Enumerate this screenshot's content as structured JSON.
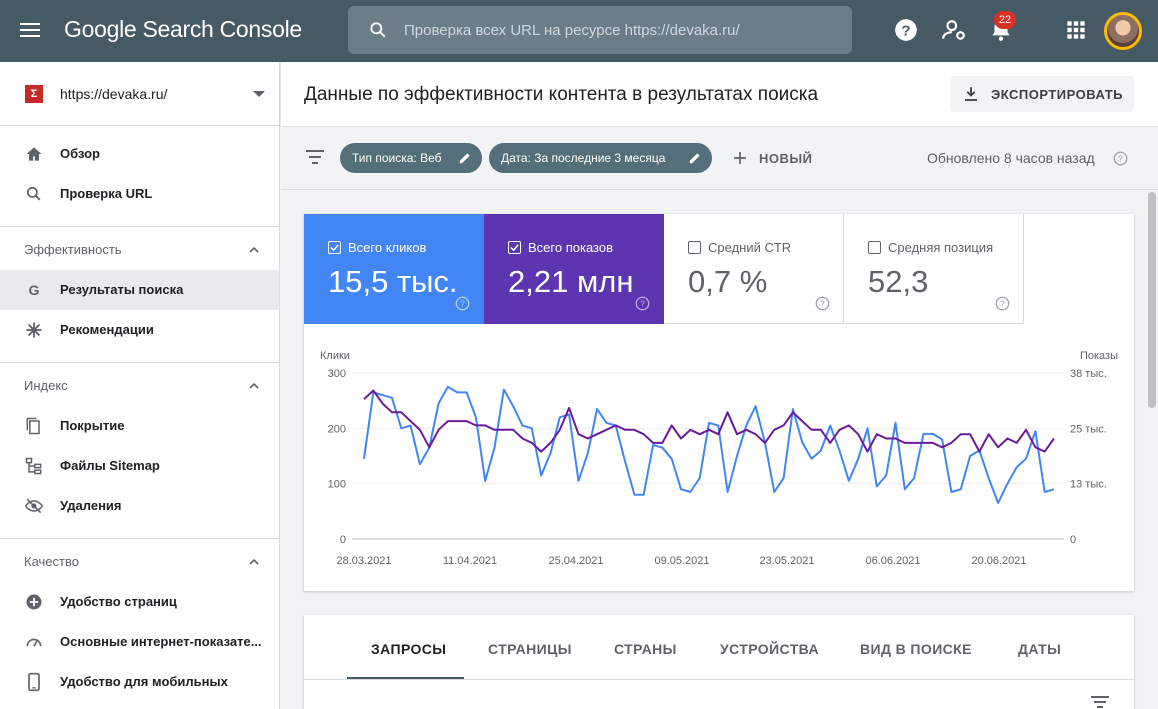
{
  "app": {
    "title": "Google Search Console",
    "search_placeholder": "Проверка всех URL на ресурсе https://devaka.ru/",
    "notifications_count": "22"
  },
  "sidebar": {
    "property": "https://devaka.ru/",
    "property_favicon": "Σ",
    "top_items": [
      {
        "label": "Обзор",
        "icon": "home-icon"
      },
      {
        "label": "Проверка URL",
        "icon": "search-icon"
      }
    ],
    "sections": [
      {
        "title": "Эффективность",
        "items": [
          {
            "label": "Результаты поиска",
            "icon": "google-g-icon",
            "active": true
          },
          {
            "label": "Рекомендации",
            "icon": "asterisk-icon"
          }
        ]
      },
      {
        "title": "Индекс",
        "items": [
          {
            "label": "Покрытие",
            "icon": "pages-icon"
          },
          {
            "label": "Файлы Sitemap",
            "icon": "sitemap-icon"
          },
          {
            "label": "Удаления",
            "icon": "eye-off-icon"
          }
        ]
      },
      {
        "title": "Качество",
        "items": [
          {
            "label": "Удобство страниц",
            "icon": "plus-circle-icon"
          },
          {
            "label": "Основные интернет-показате...",
            "icon": "speedometer-icon"
          },
          {
            "label": "Удобство для мобильных",
            "icon": "phone-icon"
          }
        ]
      }
    ]
  },
  "header": {
    "title": "Данные по эффективности контента в результатах поиска",
    "export_label": "ЭКСПОРТИРОВАТЬ"
  },
  "filters": {
    "chips": [
      "Тип поиска: Веб",
      "Дата: За последние 3 месяца"
    ],
    "new_label": "НОВЫЙ",
    "updated": "Обновлено 8 часов назад"
  },
  "metrics": [
    {
      "label": "Всего кликов",
      "value": "15,5 тыс.",
      "checked": true,
      "color": "#4285f4"
    },
    {
      "label": "Всего показов",
      "value": "2,21 млн",
      "checked": true,
      "color": "#5e35b1"
    },
    {
      "label": "Средний CTR",
      "value": "0,7 %",
      "checked": false,
      "color": "#ffffff"
    },
    {
      "label": "Средняя позиция",
      "value": "52,3",
      "checked": false,
      "color": "#ffffff"
    }
  ],
  "chart_data": {
    "type": "line",
    "left_axis_label": "Клики",
    "right_axis_label": "Показы",
    "left_ticks": [
      "300",
      "200",
      "100",
      "0"
    ],
    "right_ticks": [
      "38 тыс.",
      "25 тыс.",
      "13 тыс.",
      "0"
    ],
    "x_tick_labels": [
      "28.03.2021",
      "11.04.2021",
      "25.04.2021",
      "09.05.2021",
      "23.05.2021",
      "06.06.2021",
      "20.06.2021"
    ],
    "ylim_left": [
      0,
      300
    ],
    "ylim_right": [
      0,
      38000
    ],
    "series": [
      {
        "name": "Всего кликов",
        "axis": "left",
        "color": "#4285f4",
        "values": [
          145,
          265,
          260,
          255,
          200,
          205,
          135,
          165,
          245,
          275,
          265,
          265,
          220,
          105,
          165,
          270,
          240,
          205,
          200,
          115,
          155,
          220,
          225,
          105,
          155,
          235,
          210,
          205,
          140,
          80,
          80,
          170,
          165,
          145,
          90,
          85,
          110,
          210,
          205,
          85,
          150,
          205,
          240,
          175,
          85,
          110,
          235,
          175,
          145,
          160,
          205,
          160,
          105,
          145,
          200,
          95,
          115,
          210,
          90,
          110,
          190,
          190,
          180,
          85,
          90,
          150,
          160,
          110,
          65,
          100,
          130,
          145,
          195,
          85,
          90
        ]
      },
      {
        "name": "Всего показов",
        "axis": "right",
        "color": "#6a1b9a",
        "values": [
          32000,
          34000,
          31000,
          29000,
          29000,
          27000,
          25000,
          21000,
          25000,
          27000,
          27000,
          27000,
          26000,
          26000,
          25000,
          25000,
          25000,
          23000,
          22000,
          20000,
          22000,
          25000,
          30000,
          24000,
          23000,
          24000,
          25000,
          26000,
          25000,
          25000,
          24000,
          22000,
          22000,
          26000,
          23000,
          25000,
          24000,
          25000,
          24000,
          29000,
          24000,
          25000,
          24000,
          22000,
          25000,
          26000,
          29000,
          27000,
          25000,
          25000,
          22000,
          25000,
          26000,
          24000,
          20000,
          24000,
          23000,
          23000,
          22000,
          22000,
          22000,
          22000,
          21000,
          22000,
          24000,
          24000,
          20000,
          24000,
          21000,
          23000,
          22000,
          25000,
          21000,
          20000,
          23000
        ]
      }
    ]
  },
  "tabs": [
    "ЗАПРОСЫ",
    "СТРАНИЦЫ",
    "СТРАНЫ",
    "УСТРОЙСТВА",
    "ВИД В ПОИСКЕ",
    "ДАТЫ"
  ]
}
